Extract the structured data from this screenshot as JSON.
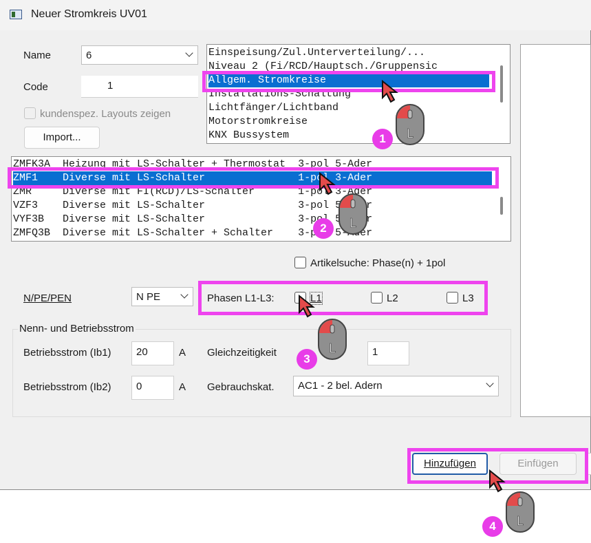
{
  "window": {
    "title": "Neuer Stromkreis  UV01"
  },
  "name_field": {
    "label": "Name",
    "value": "6"
  },
  "code_field": {
    "label": "Code",
    "value": "1"
  },
  "layouts_checkbox": {
    "label": "kundenspez. Layouts zeigen"
  },
  "import_button": {
    "label": "Import..."
  },
  "category_list": {
    "items": [
      "Einspeisung/Zul.Unterverteilung/...",
      "Niveau 2 (Fi/RCD/Hauptsch./Gruppensic",
      "Allgem. Stromkreise",
      "Installations-Schaltung",
      "Lichtfänger/Lichtband",
      "Motorstromkreise",
      "KNX Bussystem"
    ],
    "selected_index": 2
  },
  "circuit_list": {
    "items": [
      "ZMFK3A  Heizung mit LS-Schalter + Thermostat  3-pol 5-Ader",
      "ZMF1    Diverse mit LS-Schalter               1-pol 3-Ader",
      "ZMR     Diverse mit FI(RCD)/LS-Schalter       1-pol 3-Ader",
      "VZF3    Diverse mit LS-Schalter               3-pol 5-Ader",
      "VYF3B   Diverse mit LS-Schalter               3-pol 5-Ader",
      "ZMFQ3B  Diverse mit LS-Schalter + Schalter    3-pol 5-Ader"
    ],
    "selected_index": 1
  },
  "article_search": {
    "label": "Artikelsuche: Phase(n) + 1pol"
  },
  "npe": {
    "label": "N/PE/PEN",
    "value": "N PE"
  },
  "phases": {
    "label": "Phasen L1-L3:",
    "l1": "L1",
    "l2": "L2",
    "l3": "L3"
  },
  "nenn_group": {
    "title": "Nenn- und Betriebsstrom"
  },
  "ib1": {
    "label": "Betriebsstrom (Ib1)",
    "value": "20",
    "unit": "A"
  },
  "ib2": {
    "label": "Betriebsstrom (Ib2)",
    "value": "0",
    "unit": "A"
  },
  "gleichzeitigkeit": {
    "label": "Gleichzeitigkeit",
    "value": "1"
  },
  "gebrauchskat": {
    "label": "Gebrauchskat.",
    "value": "AC1 - 2 bel. Adern"
  },
  "buttons": {
    "hinzufuegen": "Hinzufügen",
    "einfuegen": "Einfügen"
  },
  "steps": [
    "1",
    "2",
    "3",
    "4"
  ],
  "colors": {
    "highlight": "#ee44ee",
    "selection": "#0a6ed1",
    "mouse_button": "#e34b4b"
  }
}
